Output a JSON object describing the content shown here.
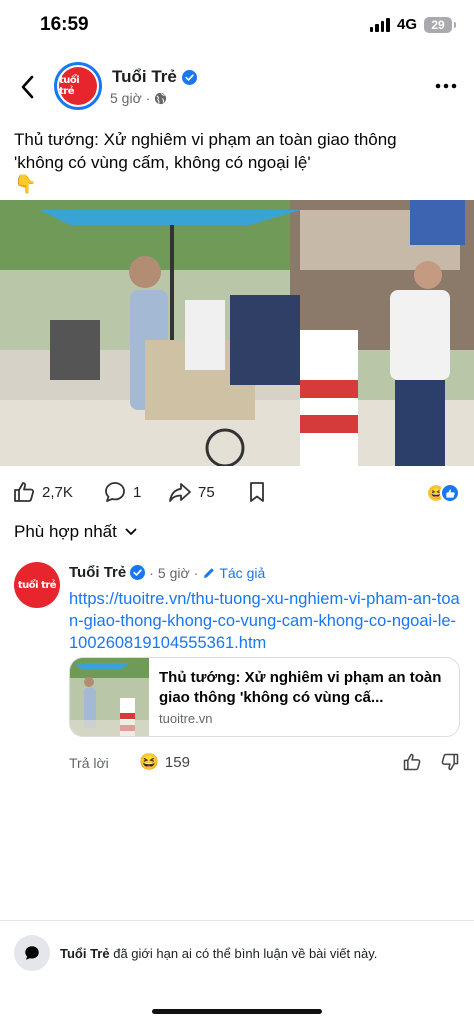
{
  "status": {
    "time": "16:59",
    "network": "4G",
    "battery": "29"
  },
  "header": {
    "page_name": "Tuổi Trẻ",
    "time_ago": "5 giờ",
    "separator": "·",
    "logo_text": "tuổi trẻ"
  },
  "post": {
    "title_line1": "Thủ tướng: Xử nghiêm vi phạm an toàn giao thông",
    "title_line2": "'không có vùng cấm, không có ngoại lệ'",
    "emoji": "👇"
  },
  "actions": {
    "likes": "2,7K",
    "comments": "1",
    "shares": "75"
  },
  "sort": {
    "label": "Phù hợp nhất"
  },
  "comment": {
    "name": "Tuổi Trẻ",
    "separator": "·",
    "time": "5 giờ",
    "author_badge": "Tác giả",
    "link": "https://tuoitre.vn/thu-tuong-xu-nghiem-vi-pham-an-toan-giao-thong-khong-co-vung-cam-khong-co-ngoai-le-100260819104555361.htm",
    "card_title": "Thủ tướng: Xử nghiêm vi phạm an toàn giao thông 'không có vùng cấ...",
    "card_domain": "tuoitre.vn",
    "reply_label": "Trả lời",
    "reaction_count": "159",
    "reaction_emoji": "😆"
  },
  "footer": {
    "page_name": "Tuổi Trẻ",
    "message": " đã giới hạn ai có thể bình luận về bài viết này."
  },
  "colors": {
    "brand_blue": "#1877f2",
    "logo_red": "#e7252d",
    "text_grey": "#65676b"
  },
  "icons": [
    "back-icon",
    "verified-icon",
    "globe-icon",
    "more-icon",
    "like-icon",
    "comment-icon",
    "share-icon",
    "bookmark-icon",
    "pencil-icon",
    "thumbs-down-icon",
    "chevron-down-icon"
  ]
}
